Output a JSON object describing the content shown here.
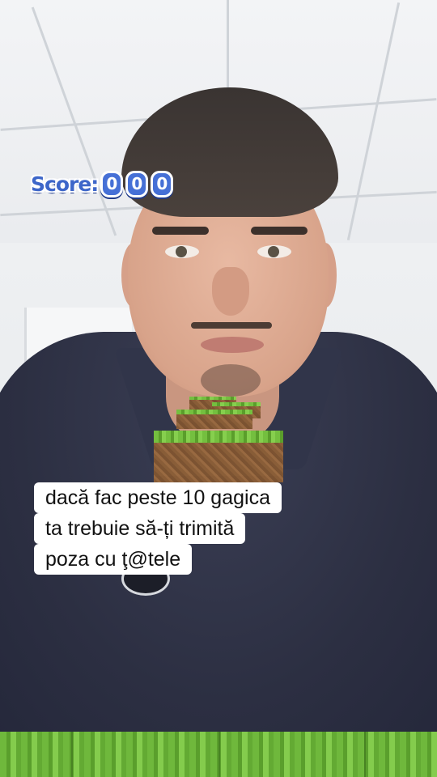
{
  "game": {
    "score_label": "Score:",
    "score_digits": [
      "0",
      "0",
      "0"
    ],
    "accent_color": "#3d66c9",
    "grass_color": "#6fb83c",
    "dirt_color": "#8d6039"
  },
  "caption": {
    "lines": [
      "dacă fac peste 10 gagica",
      "ta trebuie să-ți trimită",
      "poza cu ţ@tele"
    ]
  }
}
